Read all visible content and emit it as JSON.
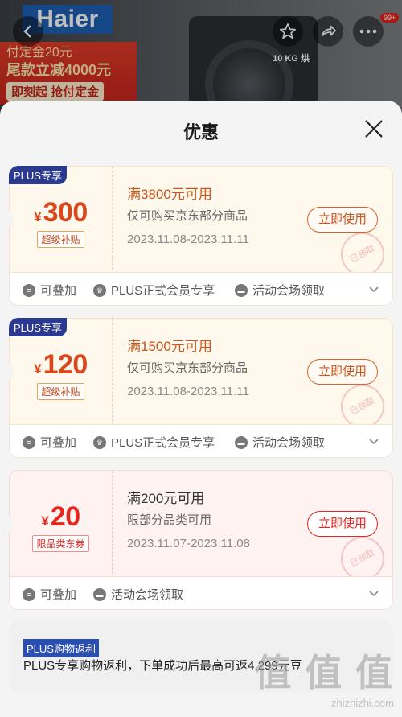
{
  "background": {
    "brand": "Haier",
    "promo_line1": "付定金20元",
    "promo_line2": "尾款立减4000元",
    "promo_line3": "即刻起 抢付定金",
    "washer_label": "10 KG 烘",
    "cart_badge": "99+"
  },
  "sheet": {
    "title": "优惠"
  },
  "coupons": [
    {
      "plus_badge": "PLUS专享",
      "yen": "¥",
      "amount": "300",
      "tag": "超级补贴",
      "condition": "满3800元可用",
      "scope": "仅可购买京东部分商品",
      "date": "2023.11.08-2023.11.11",
      "button": "立即使用",
      "stamp": "已领取",
      "foot": [
        "可叠加",
        "PLUS正式会员专享",
        "活动会场领取"
      ]
    },
    {
      "plus_badge": "PLUS专享",
      "yen": "¥",
      "amount": "120",
      "tag": "超级补贴",
      "condition": "满1500元可用",
      "scope": "仅可购买京东部分商品",
      "date": "2023.11.08-2023.11.11",
      "button": "立即使用",
      "stamp": "已领取",
      "foot": [
        "可叠加",
        "PLUS正式会员专享",
        "活动会场领取"
      ]
    },
    {
      "yen": "¥",
      "amount": "20",
      "tag": "限品类东券",
      "condition": "满200元可用",
      "scope": "限部分品类可用",
      "date": "2023.11.07-2023.11.08",
      "button": "立即使用",
      "stamp": "已领取",
      "foot": [
        "可叠加",
        "活动会场领取"
      ]
    }
  ],
  "rebate": {
    "tag": "PLUS购物返利",
    "text": "PLUS专享购物返利，下单成功后最高可返4,299元豆"
  },
  "watermark": {
    "big": "值 值 值",
    "small": "zhizhizhi.com"
  }
}
